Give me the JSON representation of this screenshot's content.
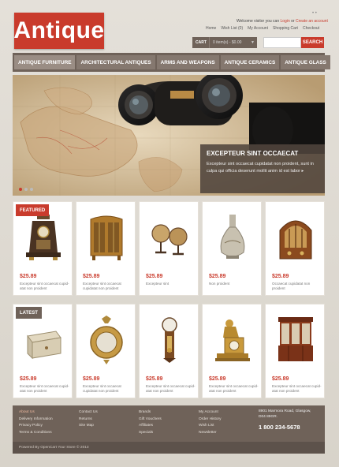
{
  "header": {
    "logo": "Antique",
    "language": "• •",
    "welcome_text": "Welcome visitor you can",
    "login": "Login",
    "or": "or",
    "create_account": "Create an account",
    "links": [
      "Home",
      "Wish List (0)",
      "My Account",
      "Shopping Cart",
      "Checkout"
    ],
    "cart_label": "CART",
    "cart_value": "0 item(s) - $0.00",
    "search_placeholder": "",
    "search_button": "SEARCH"
  },
  "nav": [
    "ANTIQUE FURNITURE",
    "ARCHITECTURAL ANTIQUES",
    "ARMS AND WEAPONS",
    "ANTIQUE CERAMICS",
    "ANTIQUE GLASS"
  ],
  "banner": {
    "title": "EXCEPTEUR SINT OCCAECAT",
    "text": "Excepteur sint occaecat cupidatat non proident, sunt in culpa qui officia deserunt mollit anim id est labor",
    "more": "▸"
  },
  "featured": {
    "label": "FEATURED",
    "items": [
      {
        "price": "$25.89",
        "desc": "Excepteur sint occaecat cupid-atat non proident",
        "icon": "mantel-clock-icon"
      },
      {
        "price": "$25.89",
        "desc": "Excepteur sint occaecat cupidatat non proident",
        "icon": "cabinet-icon"
      },
      {
        "price": "$25.89",
        "desc": "Excepteur sint",
        "icon": "globes-icon"
      },
      {
        "price": "$25.89",
        "desc": "Non proident",
        "icon": "vase-icon"
      },
      {
        "price": "$25.89",
        "desc": "Occaecat cupidatat non proident",
        "icon": "radio-icon"
      }
    ]
  },
  "latest": {
    "label": "LATEST",
    "items": [
      {
        "price": "$25.89",
        "desc": "Excepteur sint occaecat cupid-atat non proident",
        "icon": "chest-icon"
      },
      {
        "price": "$25.89",
        "desc": "Excepteur sint occaecat cupidatat non proident",
        "icon": "mirror-icon"
      },
      {
        "price": "$25.89",
        "desc": "Excepteur sint occaecat cupid-atat non proident",
        "icon": "wall-clock-icon"
      },
      {
        "price": "$25.89",
        "desc": "Excepteur sint occaecat cupid-atat non proident",
        "icon": "gilt-clock-icon"
      },
      {
        "price": "$25.89",
        "desc": "Excepteur sint occaecat cupid-atat non proident",
        "icon": "bookcase-icon"
      }
    ]
  },
  "footer": {
    "col1": [
      "About Us",
      "Delivery Information",
      "Privacy Policy",
      "Terms & Conditions"
    ],
    "col2": [
      "Contact Us",
      "Returns",
      "Site Map"
    ],
    "col3": [
      "Brands",
      "Gift Vouchers",
      "Affiliates",
      "Specials"
    ],
    "col4": [
      "My Account",
      "Order History",
      "Wish List",
      "Newsletter"
    ],
    "address": "8901 Marmora Road, Glasgow, D04 89GR.",
    "phone": "1 800 234-5678",
    "copyright": "Powered By OpenCart Your Store © 2013"
  },
  "colors": {
    "accent": "#c93b2c",
    "nav": "#6f6259",
    "background": "#d9d4cc"
  }
}
